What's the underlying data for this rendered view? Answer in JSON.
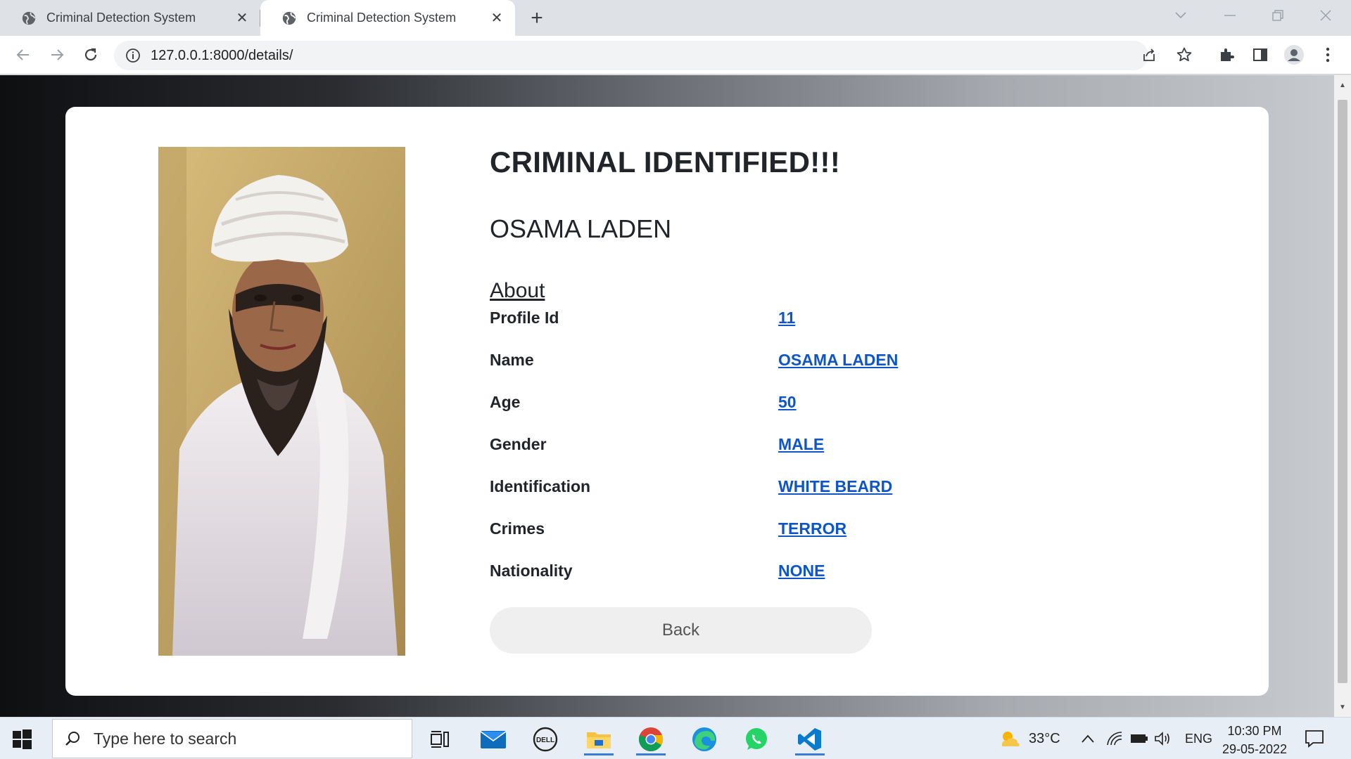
{
  "browser": {
    "tabs": [
      {
        "title": "Criminal Detection System",
        "active": false
      },
      {
        "title": "Criminal Detection System",
        "active": true
      }
    ],
    "url": "127.0.0.1:8000/details/"
  },
  "page": {
    "heading": "CRIMINAL IDENTIFIED!!!",
    "criminal_name": "OSAMA LADEN",
    "about_title": "About",
    "fields": [
      {
        "label": "Profile Id",
        "value": "11"
      },
      {
        "label": "Name",
        "value": "OSAMA LADEN"
      },
      {
        "label": "Age",
        "value": "50"
      },
      {
        "label": "Gender",
        "value": "MALE"
      },
      {
        "label": "Identification",
        "value": "WHITE BEARD"
      },
      {
        "label": "Crimes",
        "value": "TERROR"
      },
      {
        "label": "Nationality",
        "value": "NONE"
      }
    ],
    "back_label": "Back",
    "link_color": "#0d55c9"
  },
  "taskbar": {
    "search_placeholder": "Type here to search",
    "weather": "33°C",
    "language": "ENG",
    "time": "10:30 PM",
    "date": "29-05-2022",
    "apps": [
      "task-view-icon",
      "mail-icon",
      "dell-icon",
      "file-explorer-icon",
      "chrome-icon",
      "edge-icon",
      "whatsapp-icon",
      "vscode-icon"
    ]
  }
}
